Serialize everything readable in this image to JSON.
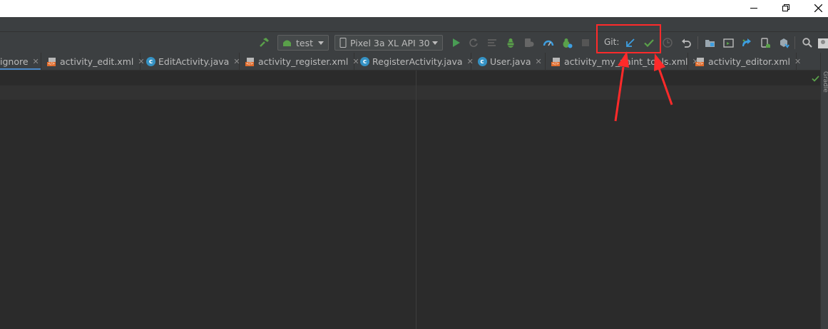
{
  "toolbar": {
    "run_config": "test",
    "device": "Pixel 3a XL API 30",
    "git_label": "Git:"
  },
  "tabs": [
    {
      "label": "ignore",
      "icon": "git-ignore-file-icon"
    },
    {
      "label": "activity_edit.xml",
      "icon": "xml-layout-icon"
    },
    {
      "label": "EditActivity.java",
      "icon": "java-class-icon"
    },
    {
      "label": "activity_register.xml",
      "icon": "xml-layout-icon"
    },
    {
      "label": "RegisterActivity.java",
      "icon": "java-class-icon"
    },
    {
      "label": "User.java",
      "icon": "java-class-icon"
    },
    {
      "label": "activity_my_paint_tools.xml",
      "icon": "xml-layout-icon"
    },
    {
      "label": "activity_editor.xml",
      "icon": "xml-layout-icon"
    }
  ],
  "side_panel": {
    "label": "Gradle"
  },
  "colors": {
    "annotation": "#ff2a2a",
    "git_update": "#3d9ee0",
    "git_commit": "#5aa04a",
    "accent": "#4a88c7"
  }
}
